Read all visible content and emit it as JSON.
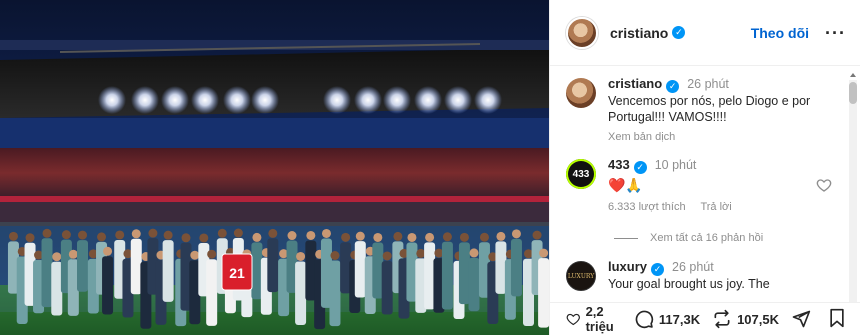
{
  "post_image": {
    "description_icon": "team-celebration-photo",
    "jersey_number": "21"
  },
  "header": {
    "username": "cristiano",
    "follow_label": "Theo dõi",
    "more_label": "···"
  },
  "comments": [
    {
      "username": "cristiano",
      "time": "26 phút",
      "text": "Vencemos por nós, pelo Diogo e por Portugal!!! VAMOS!!!!",
      "see_translation": "Xem bản dịch"
    },
    {
      "username": "433",
      "avatar_text": "433",
      "time": "10 phút",
      "text": "❤️🙏",
      "likes": "6.333 lượt thích",
      "reply": "Trả lời",
      "view_replies": "Xem tất cả 16 phản hồi"
    },
    {
      "username": "luxury",
      "avatar_text": "LUXURY",
      "time": "26 phút",
      "text": "Your goal brought us joy. The"
    }
  ],
  "actions": {
    "likes": "2,2 triệu",
    "comments": "117,3K",
    "reposts": "107,5K"
  },
  "colors": {
    "verified": "#0095f6",
    "follow": "#0064d1",
    "muted": "#8e8e8e"
  }
}
